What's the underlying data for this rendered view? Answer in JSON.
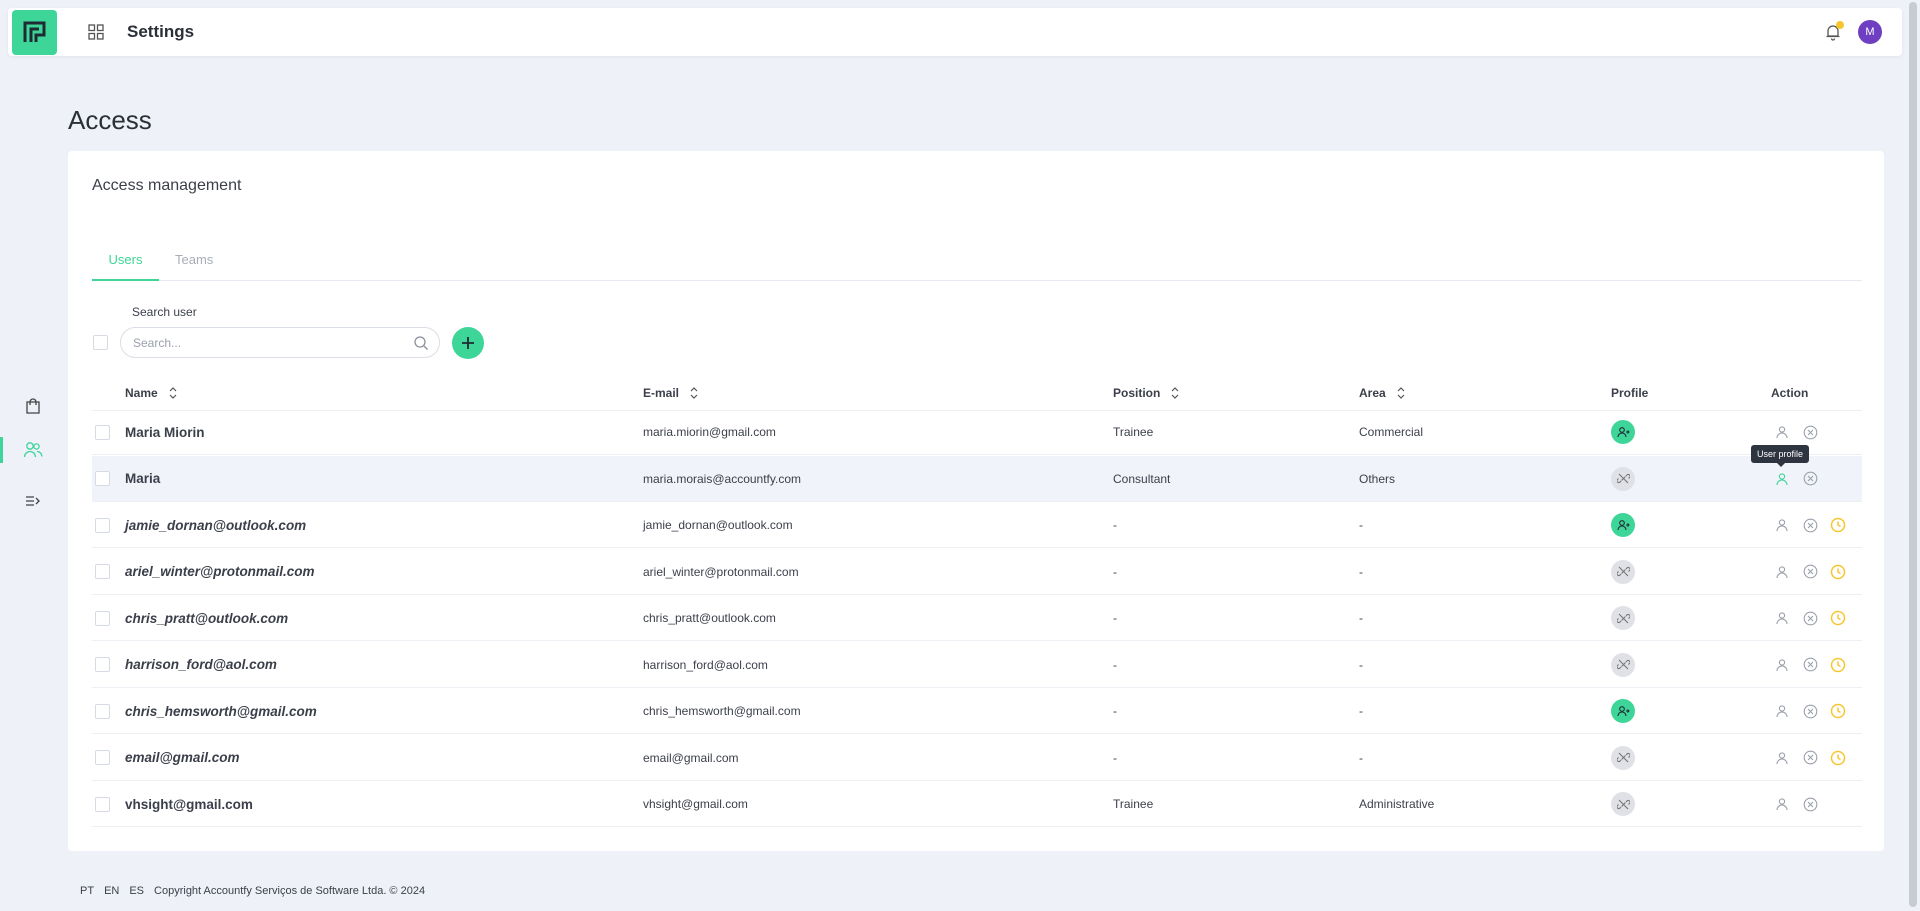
{
  "header": {
    "title": "Settings",
    "avatar_initial": "M"
  },
  "page": {
    "title": "Access"
  },
  "card": {
    "title": "Access management"
  },
  "tabs": [
    {
      "label": "Users",
      "active": true
    },
    {
      "label": "Teams",
      "active": false
    }
  ],
  "search": {
    "label": "Search user",
    "placeholder": "Search..."
  },
  "table": {
    "columns": {
      "name": "Name",
      "email": "E-mail",
      "position": "Position",
      "area": "Area",
      "profile": "Profile",
      "action": "Action"
    },
    "rows": [
      {
        "name": "Maria Miorin",
        "email": "maria.miorin@gmail.com",
        "position": "Trainee",
        "area": "Commercial",
        "profile_active": true,
        "pending": false,
        "italic": false
      },
      {
        "name": "Maria",
        "email": "maria.morais@accountfy.com",
        "position": "Consultant",
        "area": "Others",
        "profile_active": false,
        "pending": false,
        "italic": false
      },
      {
        "name": "jamie_dornan@outlook.com",
        "email": "jamie_dornan@outlook.com",
        "position": "-",
        "area": "-",
        "profile_active": true,
        "pending": true,
        "italic": true
      },
      {
        "name": "ariel_winter@protonmail.com",
        "email": "ariel_winter@protonmail.com",
        "position": "-",
        "area": "-",
        "profile_active": false,
        "pending": true,
        "italic": true
      },
      {
        "name": "chris_pratt@outlook.com",
        "email": "chris_pratt@outlook.com",
        "position": "-",
        "area": "-",
        "profile_active": false,
        "pending": true,
        "italic": true
      },
      {
        "name": "harrison_ford@aol.com",
        "email": "harrison_ford@aol.com",
        "position": "-",
        "area": "-",
        "profile_active": false,
        "pending": true,
        "italic": true
      },
      {
        "name": "chris_hemsworth@gmail.com",
        "email": "chris_hemsworth@gmail.com",
        "position": "-",
        "area": "-",
        "profile_active": true,
        "pending": true,
        "italic": true
      },
      {
        "name": "email@gmail.com",
        "email": "email@gmail.com",
        "position": "-",
        "area": "-",
        "profile_active": false,
        "pending": true,
        "italic": true
      },
      {
        "name": "vhsight@gmail.com",
        "email": "vhsight@gmail.com",
        "position": "Trainee",
        "area": "Administrative",
        "profile_active": false,
        "pending": false,
        "italic": false
      }
    ]
  },
  "tooltip": {
    "text": "User profile"
  },
  "footer": {
    "languages": [
      "PT",
      "EN",
      "ES"
    ],
    "copyright": "Copyright Accountfy Serviços de Software Ltda. © 2024"
  },
  "colors": {
    "accent": "#3dd598",
    "pending": "#f7c62f",
    "avatar": "#6f3fc1"
  }
}
